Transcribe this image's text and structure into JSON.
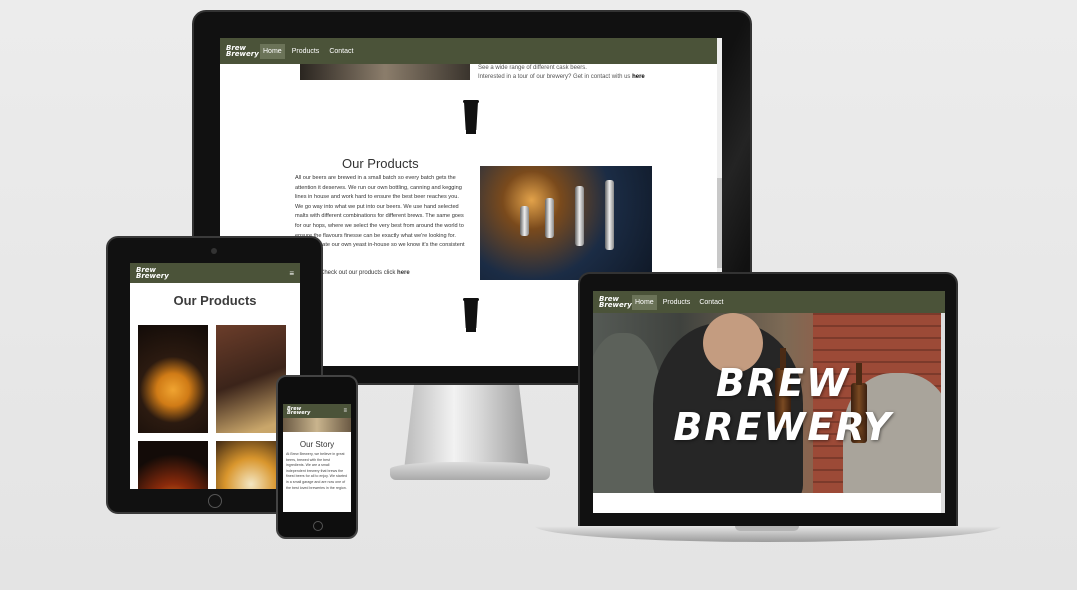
{
  "brand": {
    "logo_line1": "Brew",
    "logo_line2": "Brewery",
    "accent": "#4b5339"
  },
  "nav": {
    "home": "Home",
    "products": "Products",
    "contact": "Contact"
  },
  "desktop": {
    "top_text_line1": "See a wide range of different cask beers.",
    "top_text_line2": "Interested in a tour of our brewery? Get in contact with us",
    "top_text_link": "here",
    "products_heading": "Our Products",
    "products_paragraph": "All our beers are brewed in a small batch so every batch gets the attention it deserves. We run our own bottling, canning and kegging lines in house and work hard to ensure the best beer reaches you. We go way into what we put into our beers. We use hand selected malts with different combinations for different brews. The same goes for our hops, where we select the very best from around the world to ensure the flavours finesse can be exactly what we're looking for. We propagate our own yeast in-house so we know it's the consistent and unique",
    "products_link_prefix": "Check out our products click",
    "products_link": "here"
  },
  "tablet": {
    "heading": "Our Products",
    "menu_icon": "hamburger-icon"
  },
  "phone": {
    "heading": "Our Story",
    "paragraph": "At Brew Brewery, we believe in great beers, brewed with the best ingredients. We are a small independent brewery that brews the finest beers for all to enjoy. We started in a small garage and are now one of the best loved breweries in the region."
  },
  "laptop": {
    "hero_title_line1": "BREW",
    "hero_title_line2": "BREWERY"
  }
}
